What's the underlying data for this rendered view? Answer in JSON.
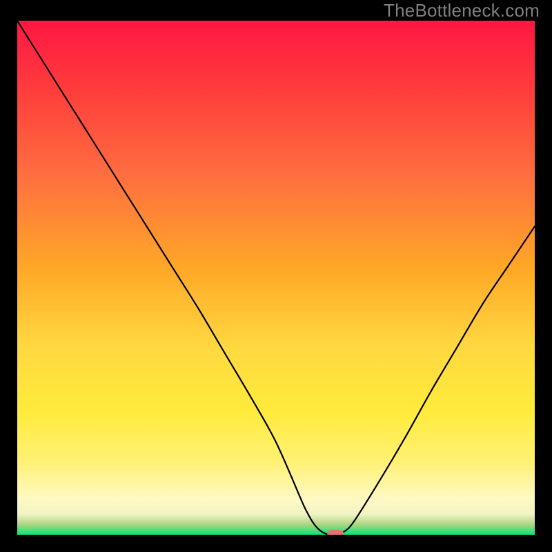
{
  "watermark": "TheBottleneck.com",
  "chart_data": {
    "type": "line",
    "title": "",
    "xlabel": "",
    "ylabel": "",
    "xlim": [
      0,
      100
    ],
    "ylim": [
      0,
      100
    ],
    "grid": false,
    "background_gradient": [
      "#ff1744",
      "#ff5722",
      "#ffc107",
      "#ffeb3b",
      "#fff176",
      "#fff9c4",
      "#00e676"
    ],
    "series": [
      {
        "name": "bottleneck-curve",
        "x": [
          0,
          5,
          10,
          15,
          20,
          25,
          30,
          35,
          40,
          45,
          50,
          55,
          56,
          57,
          58,
          59,
          60,
          61,
          62,
          63,
          65,
          70,
          75,
          80,
          85,
          90,
          95,
          100
        ],
        "y": [
          100,
          92,
          84,
          76,
          68,
          60,
          52,
          44,
          35.5,
          27,
          18,
          6.5,
          4.4,
          2.6,
          1.3,
          0.5,
          0.1,
          0.0,
          0.1,
          0.5,
          2.5,
          10.5,
          19,
          28,
          36.5,
          45,
          52.5,
          60
        ]
      }
    ],
    "marker": {
      "x": 61.5,
      "y": 0,
      "color": "#e57373",
      "shape": "rounded-rect",
      "label": ""
    }
  }
}
